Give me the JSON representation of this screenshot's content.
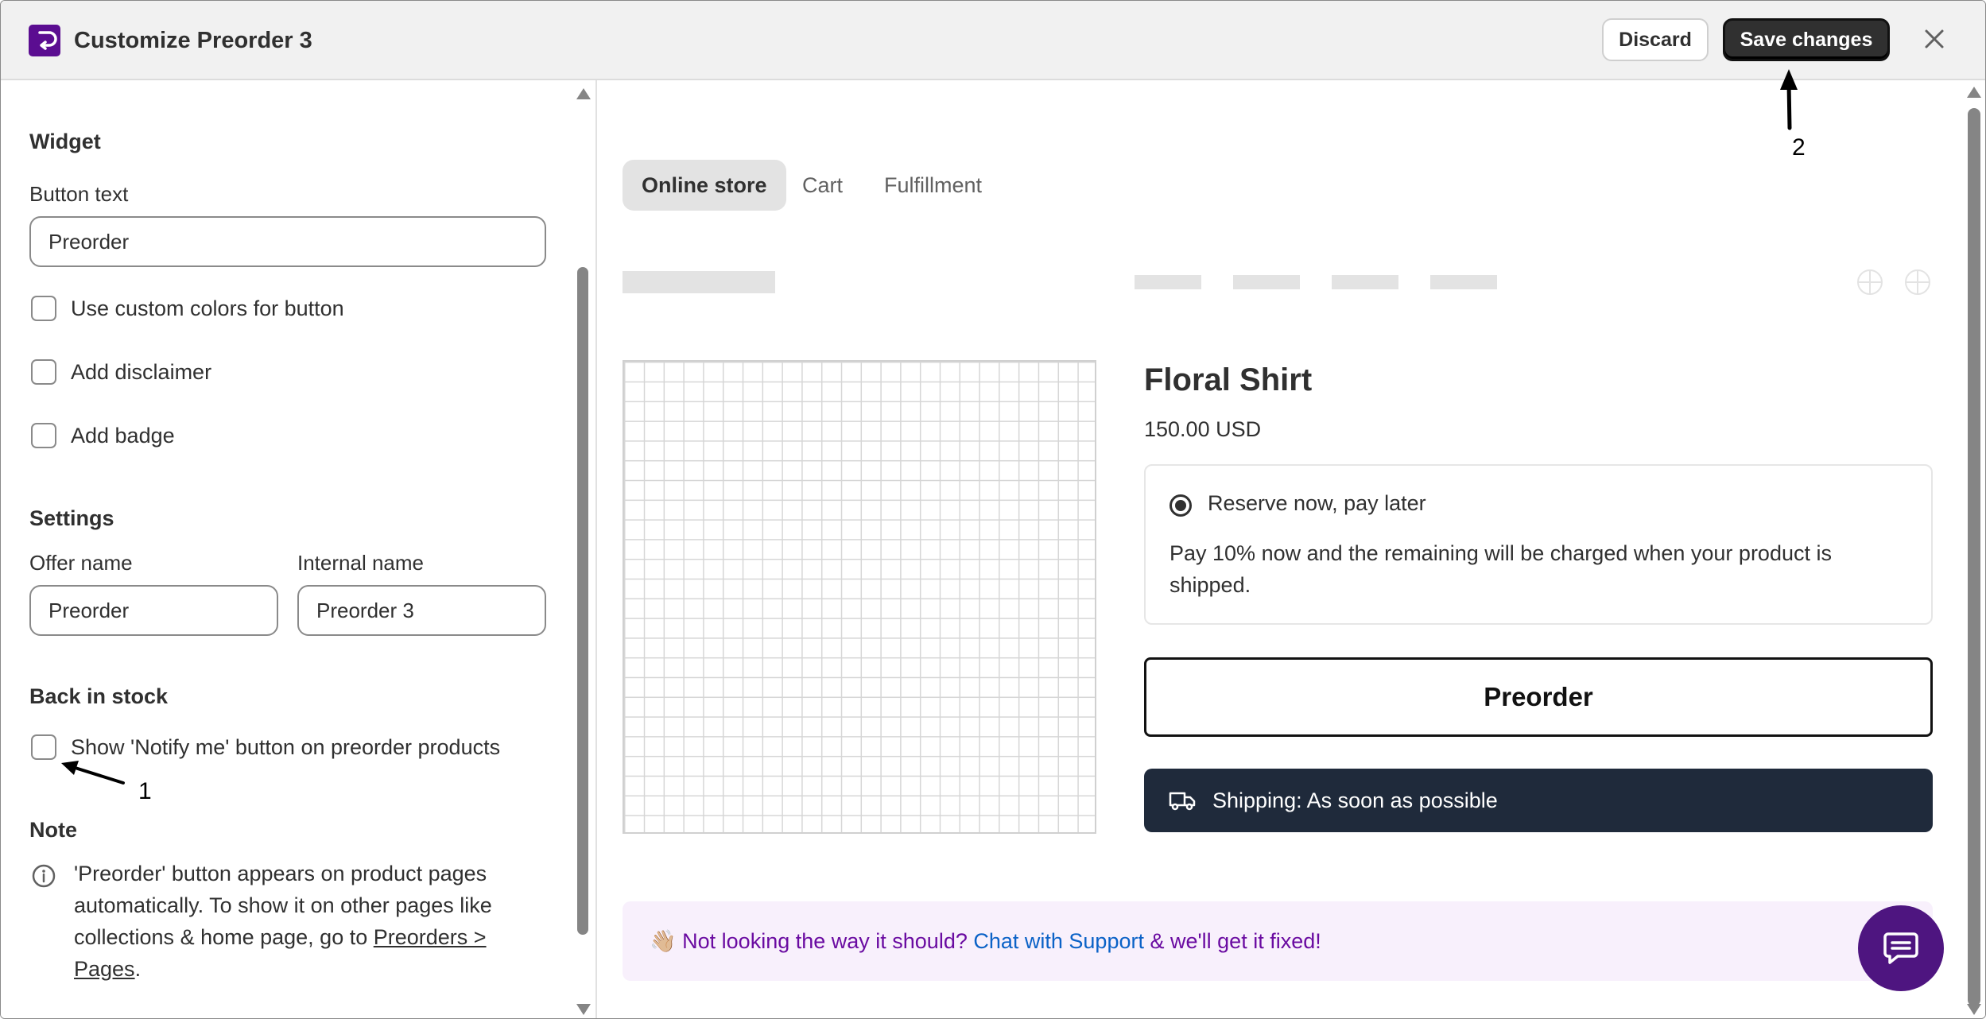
{
  "header": {
    "title": "Customize Preorder 3",
    "discard_label": "Discard",
    "save_label": "Save changes"
  },
  "left": {
    "widget": {
      "section_title": "Widget",
      "button_text_label": "Button text",
      "button_text_value": "Preorder",
      "checkboxes": [
        {
          "label": "Use custom colors for button",
          "checked": false
        },
        {
          "label": "Add disclaimer",
          "checked": false
        },
        {
          "label": "Add badge",
          "checked": false
        }
      ]
    },
    "settings": {
      "section_title": "Settings",
      "offer_name_label": "Offer name",
      "offer_name_value": "Preorder",
      "internal_name_label": "Internal name",
      "internal_name_value": "Preorder 3"
    },
    "back_in_stock": {
      "section_title": "Back in stock",
      "notify_label": "Show 'Notify me' button on preorder products",
      "notify_checked": false
    },
    "note": {
      "section_title": "Note",
      "text": "'Preorder' button appears on product pages automatically. To show it on other pages like collections & home page, go to ",
      "link": "Preorders > Pages",
      "suffix": "."
    }
  },
  "annotations": {
    "one": "1",
    "two": "2"
  },
  "preview": {
    "tabs": [
      "Online store",
      "Cart",
      "Fulfillment"
    ],
    "active_tab": "Online store",
    "product": {
      "title": "Floral Shirt",
      "price": "150.00 USD",
      "option_label": "Reserve now, pay later",
      "option_desc": "Pay 10% now and the remaining will be charged when your product is shipped.",
      "button_label": "Preorder",
      "shipping": "Shipping: As soon as possible"
    },
    "help": {
      "prefix": "Not looking the way it should? ",
      "link": "Chat with Support",
      "suffix": " & we'll get it fixed!",
      "emoji": "👋🏼"
    }
  },
  "colors": {
    "brand": "#5b0d91",
    "save_bg": "#303030",
    "shipping_bg": "#1f2a3b",
    "help_bg": "#f8f0fc",
    "help_text": "#6a0ba1",
    "link": "#0b62c7"
  }
}
